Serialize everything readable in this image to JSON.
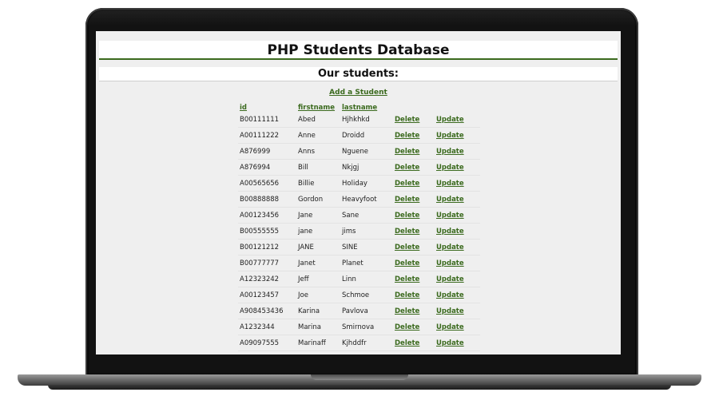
{
  "page": {
    "title": "PHP Students Database",
    "subtitle": "Our students:",
    "add_link": "Add a Student"
  },
  "table": {
    "headers": [
      "id",
      "firstname",
      "lastname"
    ],
    "delete_label": "Delete",
    "update_label": "Update",
    "rows": [
      {
        "id": "B00111111",
        "firstname": "Abed",
        "lastname": "Hjhkhkd"
      },
      {
        "id": "A00111222",
        "firstname": "Anne",
        "lastname": "Droidd"
      },
      {
        "id": "A876999",
        "firstname": "Anns",
        "lastname": "Nguene"
      },
      {
        "id": "A876994",
        "firstname": "Bill",
        "lastname": "Nkjgj"
      },
      {
        "id": "A00565656",
        "firstname": "Billie",
        "lastname": "Holiday"
      },
      {
        "id": "B00888888",
        "firstname": "Gordon",
        "lastname": "Heavyfoot"
      },
      {
        "id": "A00123456",
        "firstname": "Jane",
        "lastname": "Sane"
      },
      {
        "id": "B00555555",
        "firstname": "jane",
        "lastname": "jims"
      },
      {
        "id": "B00121212",
        "firstname": "JANE",
        "lastname": "SINE"
      },
      {
        "id": "B00777777",
        "firstname": "Janet",
        "lastname": "Planet"
      },
      {
        "id": "A12323242",
        "firstname": "Jeff",
        "lastname": "Linn"
      },
      {
        "id": "A00123457",
        "firstname": "Joe",
        "lastname": "Schmoe"
      },
      {
        "id": "A908453436",
        "firstname": "Karina",
        "lastname": "Pavlova"
      },
      {
        "id": "A1232344",
        "firstname": "Marina",
        "lastname": "Smirnova"
      },
      {
        "id": "A09097555",
        "firstname": "Marinaff",
        "lastname": "Kjhddfr"
      }
    ]
  },
  "colors": {
    "accent": "#3b6a1e",
    "page_background": "#efefef",
    "laptop_bezel": "#121212"
  }
}
